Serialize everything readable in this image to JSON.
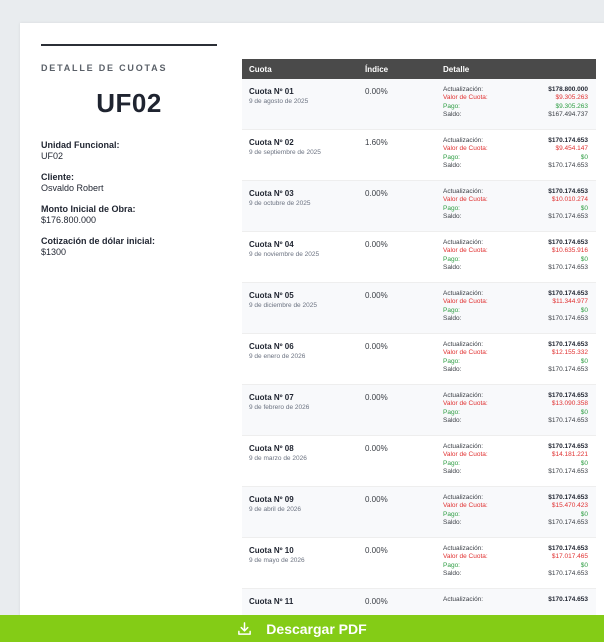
{
  "sidebar": {
    "section_title": "DETALLE DE CUOTAS",
    "unit_code": "UF02",
    "fields": [
      {
        "label": "Unidad Funcional:",
        "value": "UF02"
      },
      {
        "label": "Cliente:",
        "value": "Osvaldo Robert"
      },
      {
        "label": "Monto Inicial de Obra:",
        "value": "$176.800.000"
      },
      {
        "label": "Cotización de dólar inicial:",
        "value": "$1300"
      }
    ]
  },
  "table": {
    "headers": {
      "cuota": "Cuota",
      "indice": "Índice",
      "detalle": "Detalle"
    },
    "detail_labels": {
      "actualizacion": "Actualización:",
      "valor": "Valor de Cuota:",
      "pago": "Pago:",
      "saldo": "Saldo:"
    },
    "rows": [
      {
        "name": "Cuota Nº 01",
        "date": "9 de agosto de 2025",
        "indice": "0.00%",
        "actualizacion": "$178.800.000",
        "valor": "$9.305.263",
        "pago": "$9.305.263",
        "saldo": "$167.494.737"
      },
      {
        "name": "Cuota Nº 02",
        "date": "9 de septiembre de 2025",
        "indice": "1.60%",
        "actualizacion": "$170.174.653",
        "valor": "$9.454.147",
        "pago": "$0",
        "saldo": "$170.174.653"
      },
      {
        "name": "Cuota Nº 03",
        "date": "9 de octubre de 2025",
        "indice": "0.00%",
        "actualizacion": "$170.174.653",
        "valor": "$10.010.274",
        "pago": "$0",
        "saldo": "$170.174.653"
      },
      {
        "name": "Cuota Nº 04",
        "date": "9 de noviembre de 2025",
        "indice": "0.00%",
        "actualizacion": "$170.174.653",
        "valor": "$10.635.916",
        "pago": "$0",
        "saldo": "$170.174.653"
      },
      {
        "name": "Cuota Nº 05",
        "date": "9 de diciembre de 2025",
        "indice": "0.00%",
        "actualizacion": "$170.174.653",
        "valor": "$11.344.977",
        "pago": "$0",
        "saldo": "$170.174.653"
      },
      {
        "name": "Cuota Nº 06",
        "date": "9 de enero de 2026",
        "indice": "0.00%",
        "actualizacion": "$170.174.653",
        "valor": "$12.155.332",
        "pago": "$0",
        "saldo": "$170.174.653"
      },
      {
        "name": "Cuota Nº 07",
        "date": "9 de febrero de 2026",
        "indice": "0.00%",
        "actualizacion": "$170.174.653",
        "valor": "$13.090.358",
        "pago": "$0",
        "saldo": "$170.174.653"
      },
      {
        "name": "Cuota Nº 08",
        "date": "9 de marzo de 2026",
        "indice": "0.00%",
        "actualizacion": "$170.174.653",
        "valor": "$14.181.221",
        "pago": "$0",
        "saldo": "$170.174.653"
      },
      {
        "name": "Cuota Nº 09",
        "date": "9 de abril de 2026",
        "indice": "0.00%",
        "actualizacion": "$170.174.653",
        "valor": "$15.470.423",
        "pago": "$0",
        "saldo": "$170.174.653"
      },
      {
        "name": "Cuota Nº 10",
        "date": "9 de mayo de 2026",
        "indice": "0.00%",
        "actualizacion": "$170.174.653",
        "valor": "$17.017.465",
        "pago": "$0",
        "saldo": "$170.174.653"
      },
      {
        "name": "Cuota Nº 11",
        "date": "",
        "indice": "0.00%",
        "actualizacion": "$170.174.653",
        "valor": "",
        "pago": "",
        "saldo": ""
      }
    ]
  },
  "download": {
    "label": "Descargar PDF",
    "icon": "download-icon"
  },
  "colors": {
    "accent": "#84cc16",
    "header": "#4a4a4a",
    "negative": "#e03131",
    "positive": "#2f9e44"
  }
}
